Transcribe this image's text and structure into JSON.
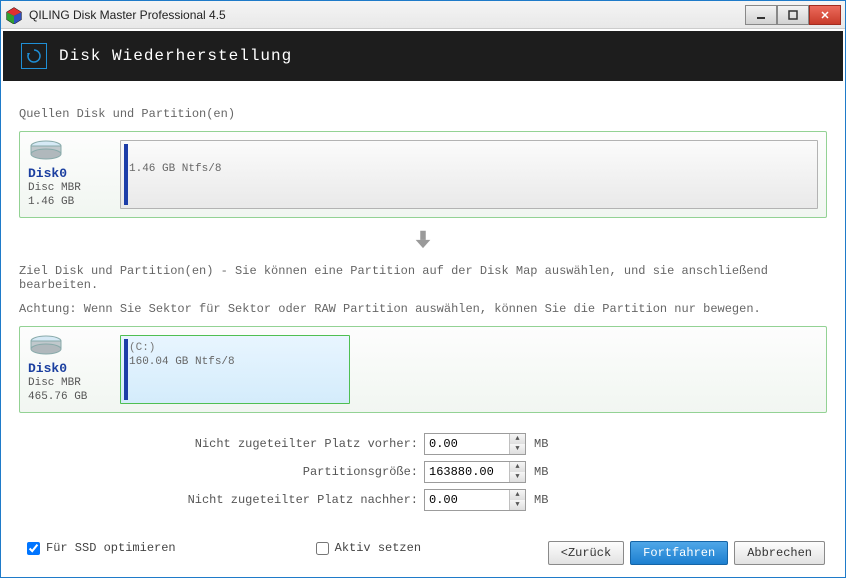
{
  "window": {
    "title": "QILING Disk Master Professional 4.5"
  },
  "header": {
    "title": "Disk Wiederherstellung"
  },
  "source": {
    "label": "Quellen Disk und Partition(en)",
    "disk_name": "Disk0",
    "disk_type": "Disc MBR",
    "disk_size": "1.46 GB",
    "partition_text": "1.46 GB Ntfs/8"
  },
  "target": {
    "label": "Ziel Disk und Partition(en) - Sie können eine Partition auf der Disk Map auswählen, und sie anschließend bearbeiten.",
    "warning": "Achtung: Wenn Sie Sektor für Sektor oder RAW Partition auswählen, können Sie die Partition nur bewegen.",
    "disk_name": "Disk0",
    "disk_type": "Disc MBR",
    "disk_size": "465.76 GB",
    "partition_label": "(C:)",
    "partition_text": "160.04 GB Ntfs/8"
  },
  "form": {
    "before_label": "Nicht zugeteilter Platz vorher:",
    "before_value": "0.00",
    "size_label": "Partitionsgröße:",
    "size_value": "163880.00",
    "after_label": "Nicht zugeteilter Platz nachher:",
    "after_value": "0.00",
    "unit": "MB"
  },
  "checks": {
    "ssd_label": "Für SSD optimieren",
    "active_label": "Aktiv setzen"
  },
  "buttons": {
    "back": "<Zurück",
    "next": "Fortfahren",
    "cancel": "Abbrechen"
  }
}
